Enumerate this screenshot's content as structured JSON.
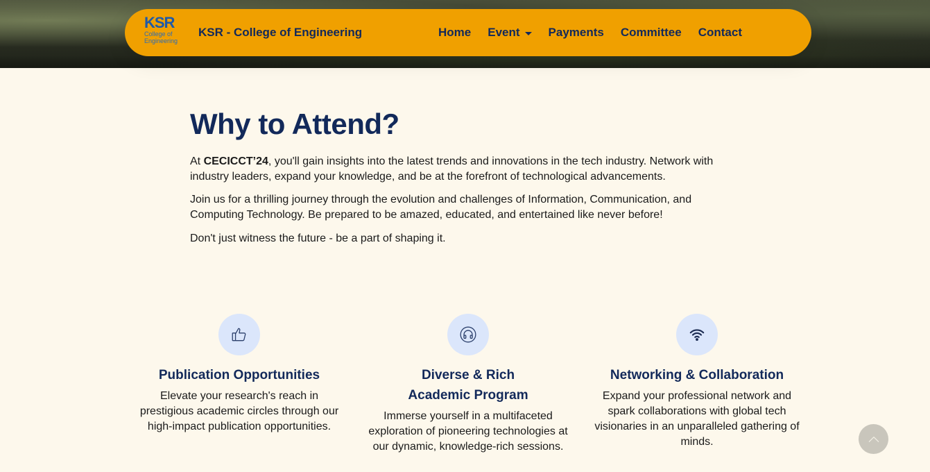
{
  "nav": {
    "logo_big": "KSR",
    "logo_small_1": "College of",
    "logo_small_2": "Engineering",
    "brand": "KSR - College of Engineering",
    "links": [
      "Home",
      "Event",
      "Payments",
      "Committee",
      "Contact"
    ]
  },
  "section": {
    "title": "Why to Attend?",
    "p1_prefix": "At ",
    "p1_bold": "CECICCT’24",
    "p1_rest": ", you'll gain insights into the latest trends and innovations in the tech industry. Network with industry leaders, expand your knowledge, and be at the forefront of technological advancements.",
    "p2": "Join us for a thrilling journey through the evolution and challenges of Information, Communication, and Computing Technology. Be prepared to be amazed, educated, and entertained like never before!",
    "p3": "Don't just witness the future - be a part of shaping it."
  },
  "features": [
    {
      "icon": "thumbs-up-icon",
      "title": "Publication Opportunities",
      "desc": "Elevate your research's reach in prestigious academic circles through our high-impact publication opportunities."
    },
    {
      "icon": "headphones-icon",
      "title": "Diverse & Rich Academic Program",
      "desc": "Immerse yourself in a multifaceted exploration of pioneering technologies at our dynamic, knowledge-rich sessions."
    },
    {
      "icon": "wifi-icon",
      "title": "Networking & Collaboration",
      "desc": "Expand your professional network and spark collaborations with global tech visionaries in an unparalleled gathering of minds."
    }
  ],
  "colors": {
    "navbar": "#f0a000",
    "heading": "#12295a",
    "background": "#fdf8ec",
    "icon_circle": "#dbe6fb"
  }
}
